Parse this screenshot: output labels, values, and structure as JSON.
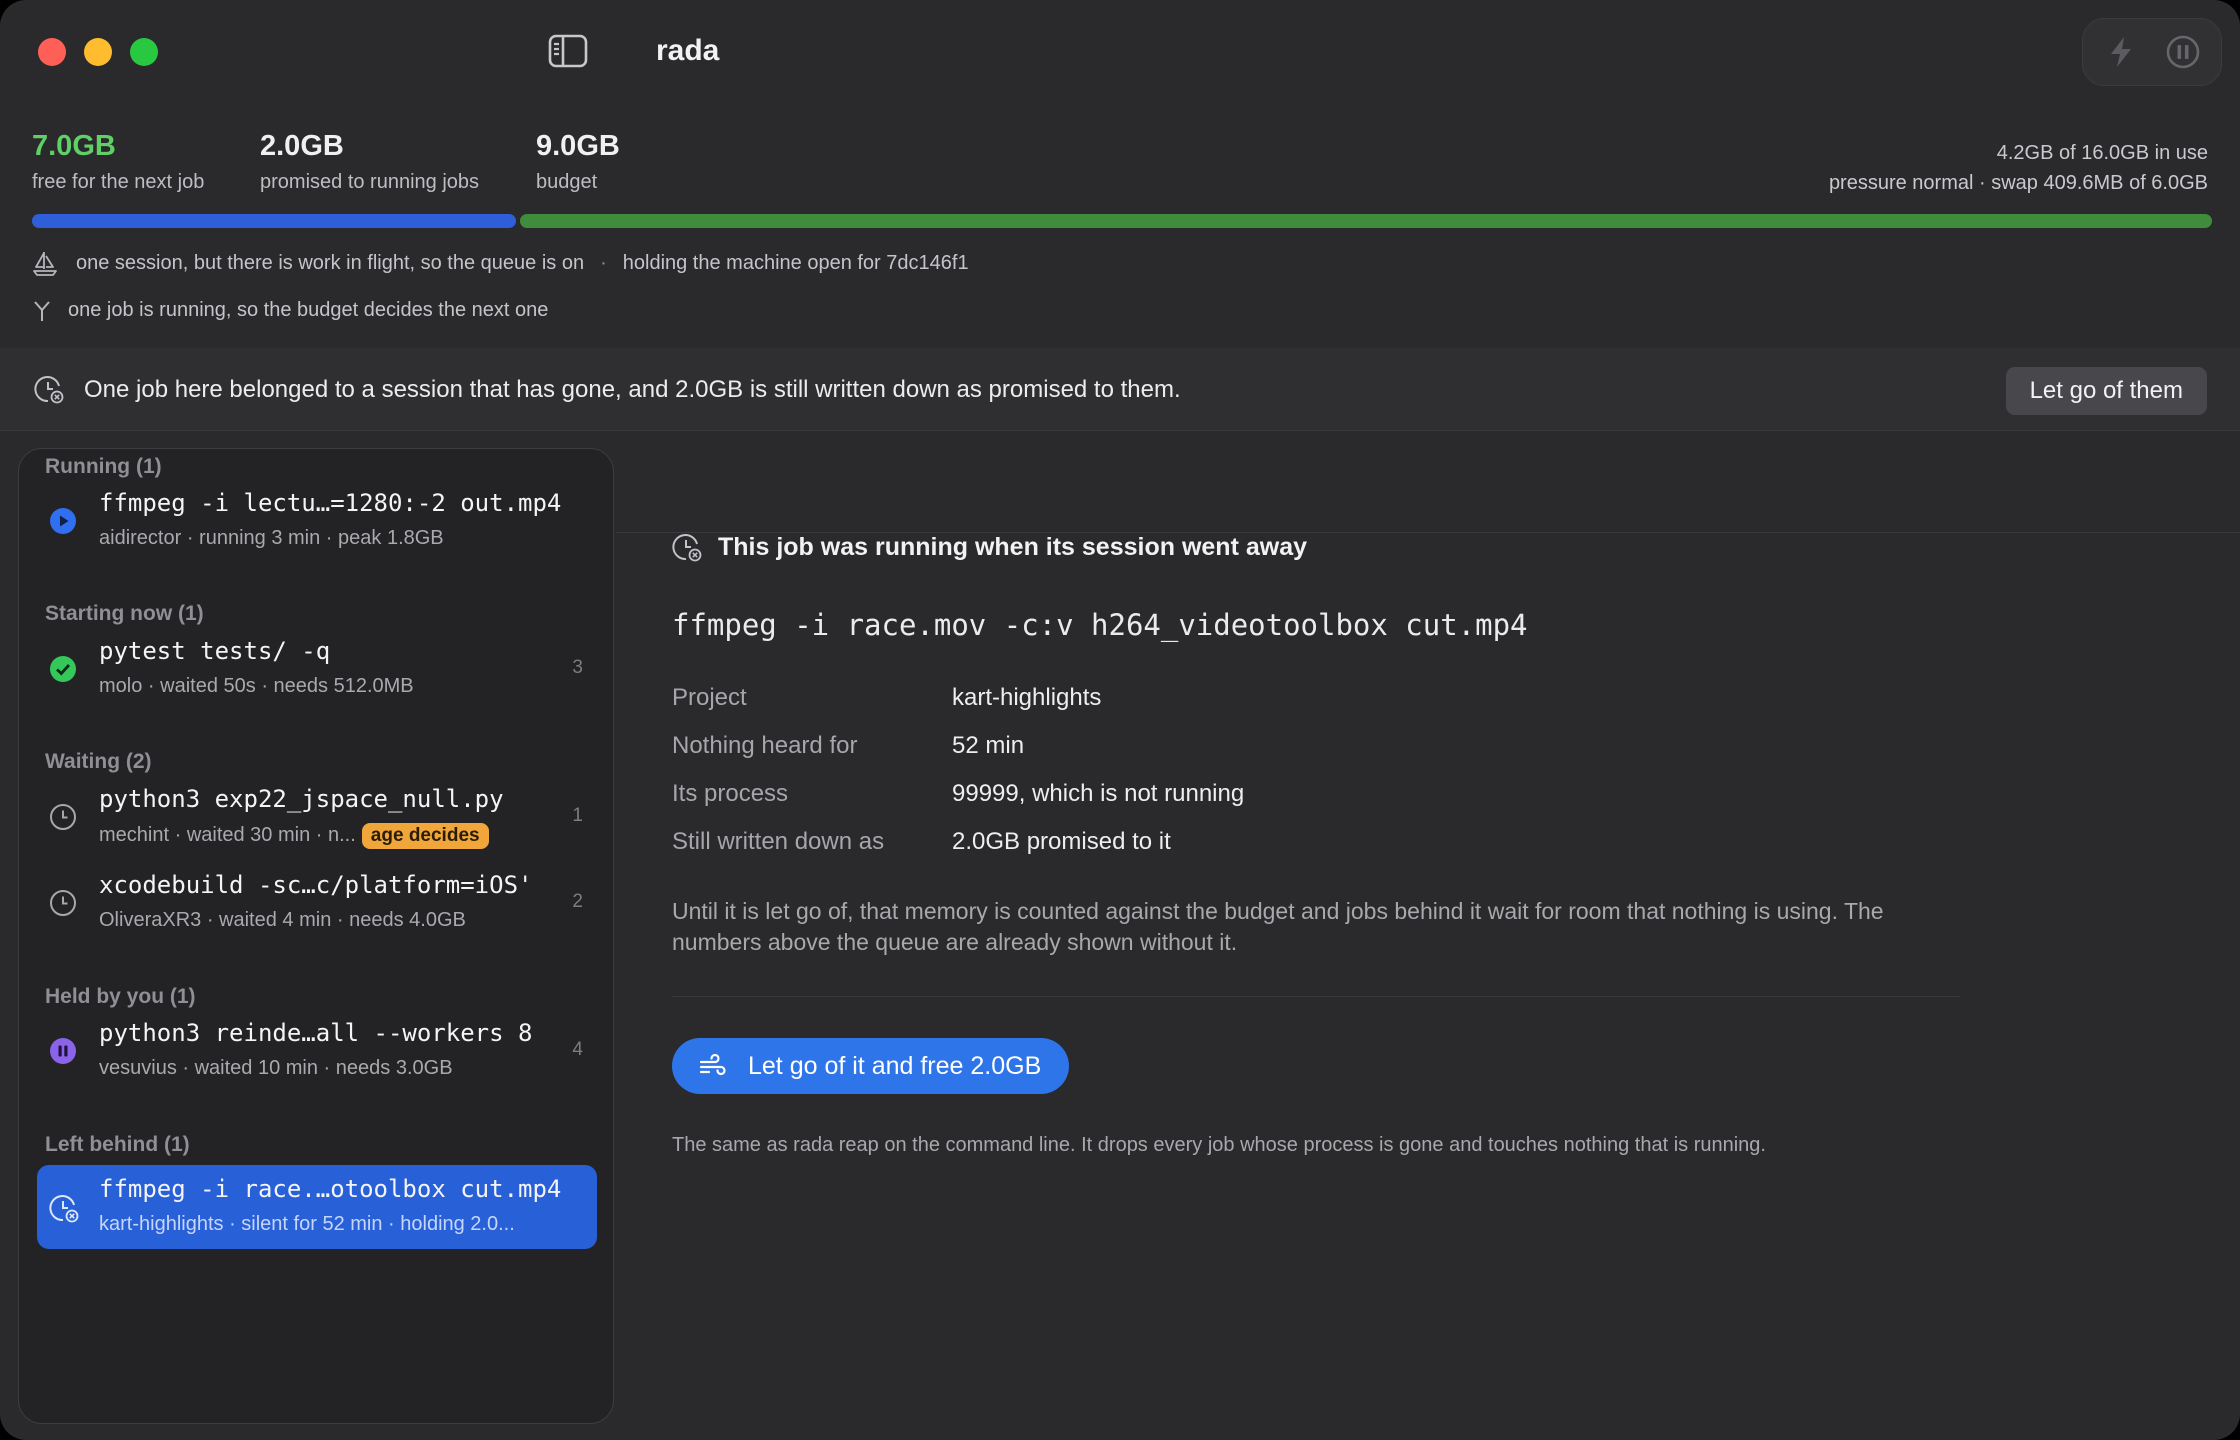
{
  "window": {
    "title": "rada"
  },
  "stats": [
    {
      "value": "7.0GB",
      "label": "free for the next job",
      "color": "#5fd065"
    },
    {
      "value": "2.0GB",
      "label": "promised to running jobs",
      "color": "#f0f0f2"
    },
    {
      "value": "9.0GB",
      "label": "budget",
      "color": "#f0f0f2"
    }
  ],
  "memory": {
    "in_use": "4.2GB of 16.0GB in use",
    "pressure": "pressure normal · swap 409.6MB of 6.0GB",
    "promised_fraction": 0.222,
    "colors": {
      "promised": "#2f5fd8",
      "free": "#3f8c3d"
    }
  },
  "status": {
    "session_line": "one session, but there is work in flight, so the queue is on",
    "hold_line": "holding the machine open for 7dc146f1",
    "budget_line": "one job is running, so the budget decides the next one"
  },
  "banner": {
    "text": "One job here belonged to a session that has gone, and 2.0GB is still written down as promised to them.",
    "button": "Let go of them"
  },
  "queue": {
    "groups": [
      {
        "header": "Running (1)",
        "jobs": [
          {
            "cmd": "ffmpeg -i lectu…=1280:-2 out.mp4",
            "meta": [
              "aidirector",
              "running 3 min",
              "peak 1.8GB"
            ],
            "num": "",
            "icon": "play-icon"
          }
        ]
      },
      {
        "header": "Starting now (1)",
        "jobs": [
          {
            "cmd": "pytest tests/ -q",
            "meta": [
              "molo",
              "waited 50s",
              "needs 512.0MB"
            ],
            "num": "3",
            "icon": "check-icon"
          }
        ]
      },
      {
        "header": "Waiting (2)",
        "jobs": [
          {
            "cmd": "python3 exp22_jspace_null.py",
            "meta": [
              "mechint",
              "waited 30 min",
              "n..."
            ],
            "badge": "age decides",
            "num": "1",
            "icon": "clock-icon"
          },
          {
            "cmd": "xcodebuild -sc…c/platform=iOS'",
            "meta": [
              "OliveraXR3",
              "waited 4 min",
              "needs 4.0GB"
            ],
            "num": "2",
            "icon": "clock-icon"
          }
        ]
      },
      {
        "header": "Held by you (1)",
        "jobs": [
          {
            "cmd": "python3 reinde…all --workers 8",
            "meta": [
              "vesuvius",
              "waited 10 min",
              "needs 3.0GB"
            ],
            "num": "4",
            "icon": "pause-icon"
          }
        ]
      },
      {
        "header": "Left behind (1)",
        "jobs": [
          {
            "cmd": "ffmpeg -i race.…otoolbox cut.mp4",
            "meta": [
              "kart-highlights",
              "silent for 52 min",
              "holding 2.0..."
            ],
            "num": "",
            "icon": "orphan-icon",
            "selected": true
          }
        ]
      }
    ]
  },
  "detail": {
    "heading": "This job was running when its session went away",
    "command": "ffmpeg -i race.mov -c:v h264_videotoolbox cut.mp4",
    "fields": [
      {
        "key": "Project",
        "value": "kart-highlights"
      },
      {
        "key": "Nothing heard for",
        "value": "52 min"
      },
      {
        "key": "Its process",
        "value": "99999, which is not running"
      },
      {
        "key": "Still written down as",
        "value": "2.0GB promised to it"
      }
    ],
    "explanation": "Until it is let go of, that memory is counted against the budget and jobs behind it wait for room that nothing is using. The numbers above the queue are already shown without it.",
    "action": "Let go of it and free 2.0GB",
    "footnote": "The same as rada reap on the command line. It drops every job whose process is gone and touches nothing that is running."
  }
}
